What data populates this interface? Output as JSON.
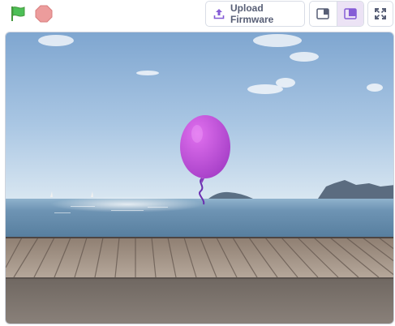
{
  "toolbar": {
    "green_flag_icon": "green-flag-icon",
    "stop_icon": "stop-icon",
    "upload_label": "Upload Firmware",
    "upload_icon": "upload-icon",
    "layout_small_icon": "small-stage-icon",
    "layout_large_icon": "large-stage-icon",
    "fullscreen_icon": "fullscreen-icon"
  },
  "colors": {
    "flag_green": "#4cbf56",
    "stop_red": "#ec9c9c",
    "purple": "#855cd6",
    "balloon": "#b84ed6",
    "border": "#d9dde6"
  },
  "stage": {
    "backdrop": "boardwalk-seaside",
    "sprite": "balloon"
  }
}
